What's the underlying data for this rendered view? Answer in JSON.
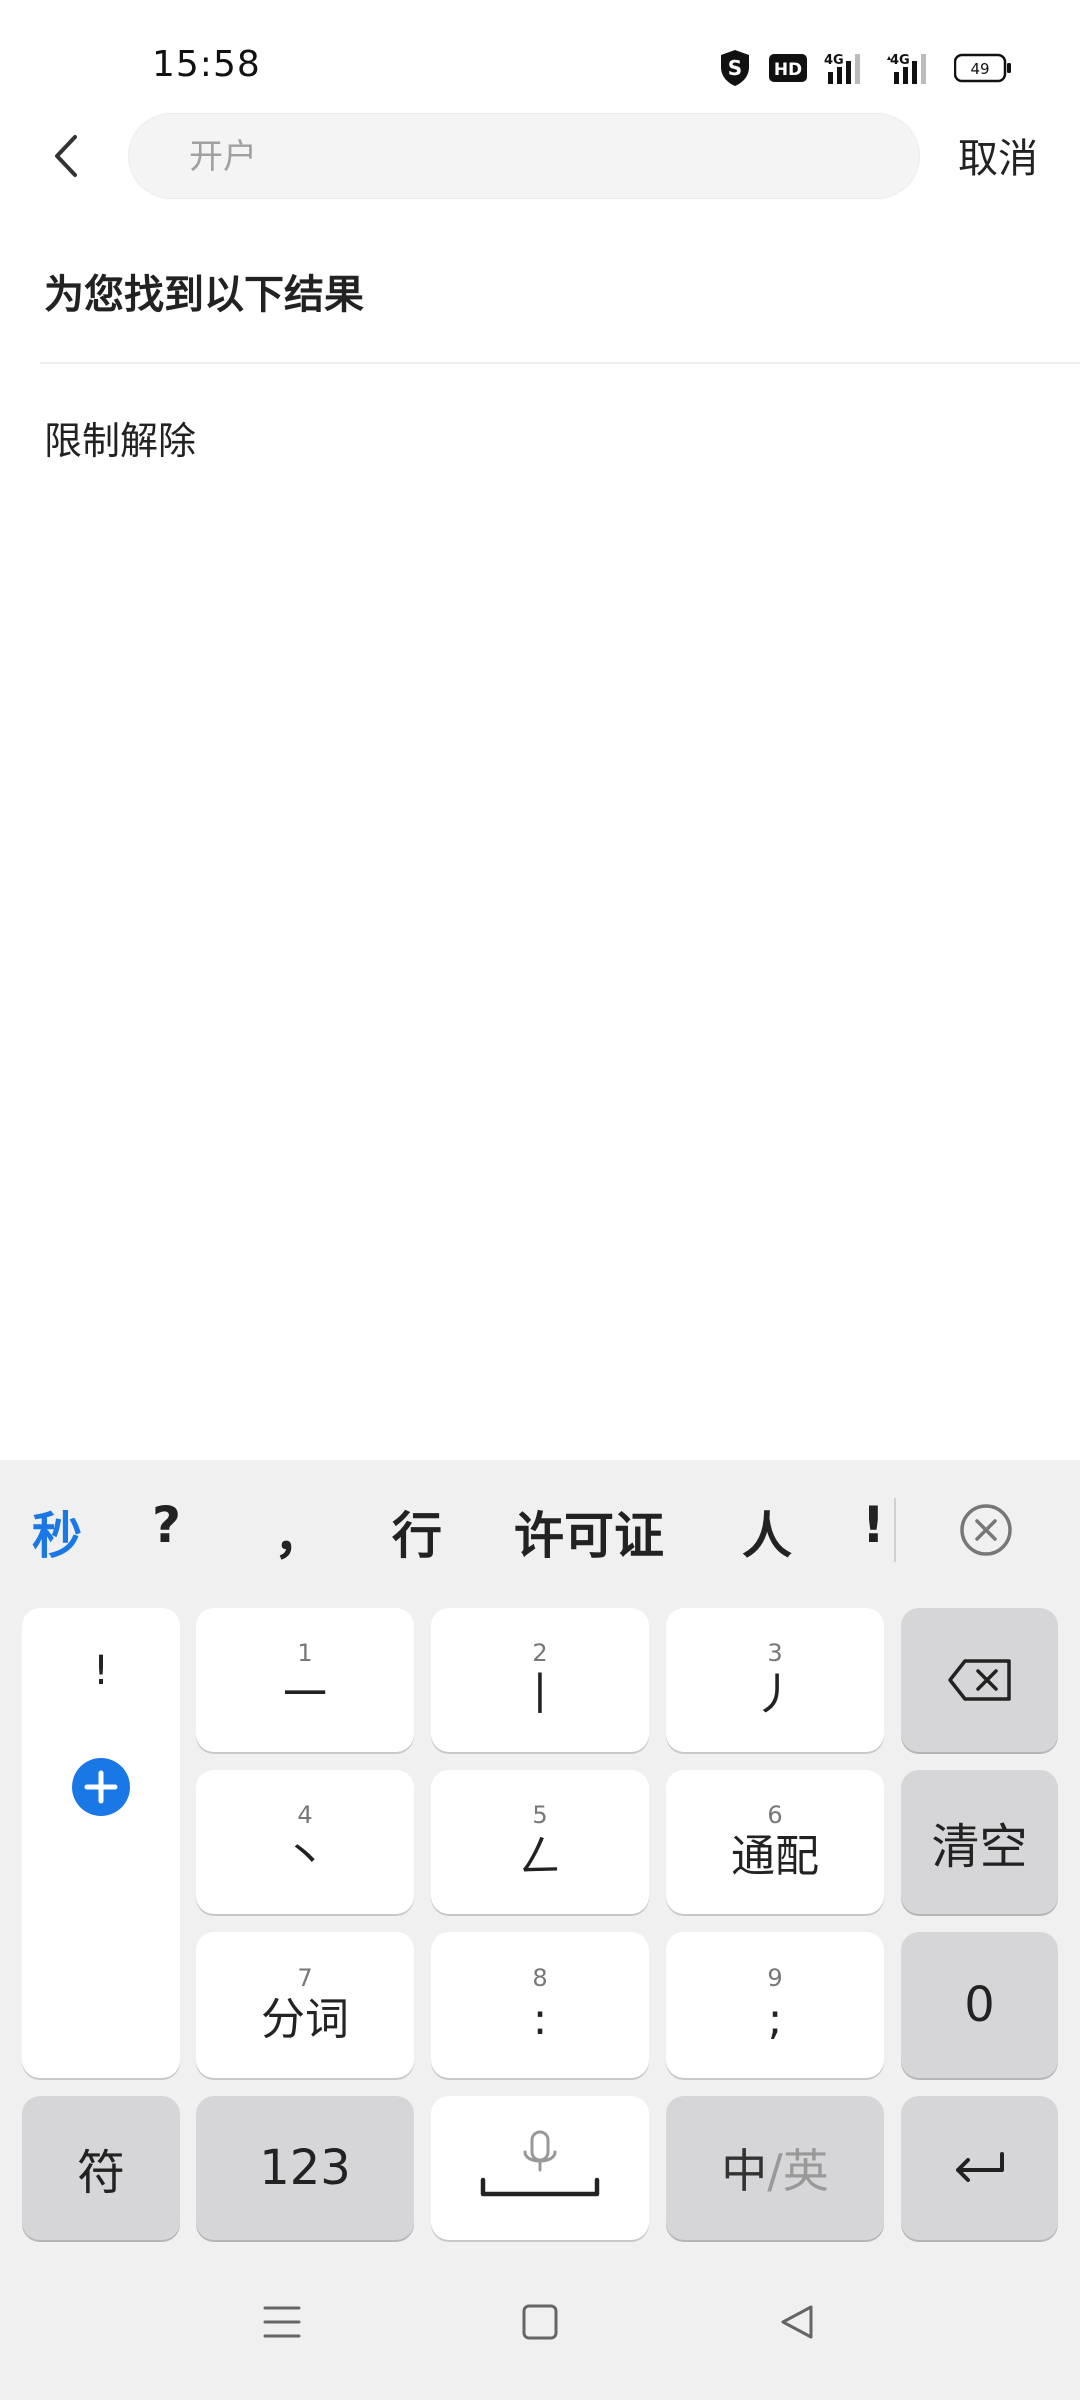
{
  "status_bar": {
    "time": "15:58",
    "battery": "49",
    "hd_label": "HD",
    "net1": "4G",
    "net2": "4G"
  },
  "search": {
    "placeholder": "开户",
    "cancel_label": "取消"
  },
  "results": {
    "header": "为您找到以下结果",
    "items": [
      "限制解除"
    ]
  },
  "keyboard": {
    "candidates": [
      "秒",
      "?",
      "，",
      "行",
      "许可证",
      "人",
      "!"
    ],
    "left_column": {
      "symbol": "!"
    },
    "keys": [
      {
        "num": "1",
        "label": "一"
      },
      {
        "num": "2",
        "label": "丨"
      },
      {
        "num": "3",
        "label": "丿"
      },
      {
        "num": "4",
        "label": "丶"
      },
      {
        "num": "5",
        "label": "ㄥ"
      },
      {
        "num": "6",
        "label": "通配"
      },
      {
        "num": "7",
        "label": "分词"
      },
      {
        "num": "8",
        "label": ":"
      },
      {
        "num": "9",
        "label": ";"
      }
    ],
    "clear_label": "清空",
    "zero_label": "0",
    "symbol_label": "符",
    "num_label": "123",
    "lang_zh": "中",
    "lang_sep": "/",
    "lang_en": "英"
  },
  "colors": {
    "accent": "#1a78e6"
  }
}
